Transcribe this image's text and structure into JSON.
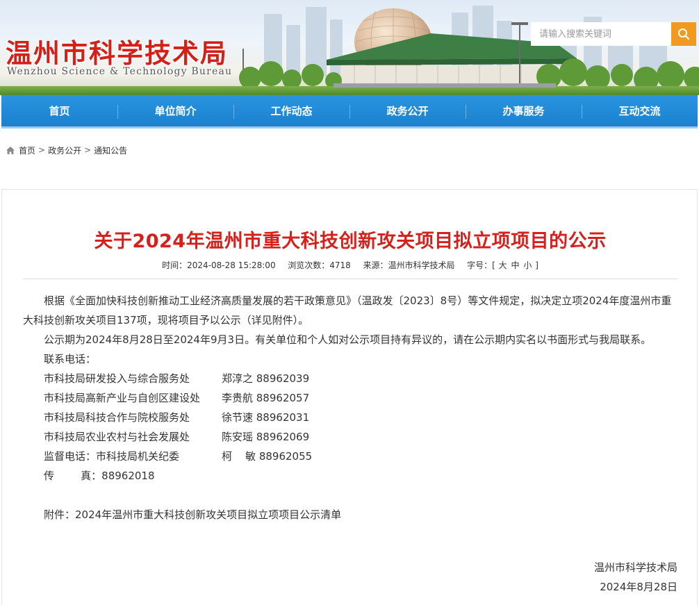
{
  "site": {
    "title": "温州市科学技术局",
    "subtitle": "Wenzhou Science & Technology Bureau"
  },
  "search": {
    "placeholder": "请输入搜索关键词",
    "icon": "search-icon"
  },
  "nav": {
    "items": [
      "首页",
      "单位简介",
      "工作动态",
      "政务公开",
      "办事服务",
      "互动交流"
    ]
  },
  "breadcrumb": {
    "icon": "home-icon",
    "items": [
      "首页",
      "政务公开",
      "通知公告"
    ],
    "separator": ">"
  },
  "article": {
    "title": "关于2024年温州市重大科技创新攻关项目拟立项项目的公示",
    "meta": {
      "time_label": "时间：",
      "time": "2024-08-28 15:28:00",
      "views_label": "浏览次数：",
      "views": "4718",
      "source_label": "来源：",
      "source": "温州市科学技术局",
      "fontsize_label": "字号：[",
      "font_large": "大",
      "font_medium": "中",
      "font_small": "小",
      "fontsize_end": "]"
    },
    "para1": "根据《全面加快科技创新推动工业经济高质量发展的若干政策意见》（温政发〔2023〕8号）等文件规定，拟决定立项2024年度温州市重大科技创新攻关项目137项，现将项目予以公示（详见附件）。",
    "para2": "公示期为2024年8月28日至2024年9月3日。有关单位和个人如对公示项目持有异议的，请在公示期内实名以书面形式与我局联系。",
    "contact_label": "联系电话：",
    "contacts": [
      {
        "dept": "市科技局研发投入与综合服务处",
        "person": "郑淳之 88962039"
      },
      {
        "dept": "市科技局高新产业与自创区建设处",
        "person": "李贵航 88962057"
      },
      {
        "dept": "市科技局科技合作与院校服务处",
        "person": "徐节速 88962031"
      },
      {
        "dept": "市科技局农业农村与社会发展处",
        "person": "陈安瑶 88962069"
      },
      {
        "dept": "监督电话：市科技局机关纪委",
        "person": "柯    敏 88962055"
      }
    ],
    "fax": "传        真：88962018",
    "attachment": "附件：2024年温州市重大科技创新攻关项目拟立项项目公示清单",
    "signature_org": "温州市科学技术局",
    "signature_date": "2024年8月28日"
  },
  "colors": {
    "title_red": "#d3211a",
    "nav_blue": "#1a80cf",
    "search_orange": "#f09a22"
  }
}
